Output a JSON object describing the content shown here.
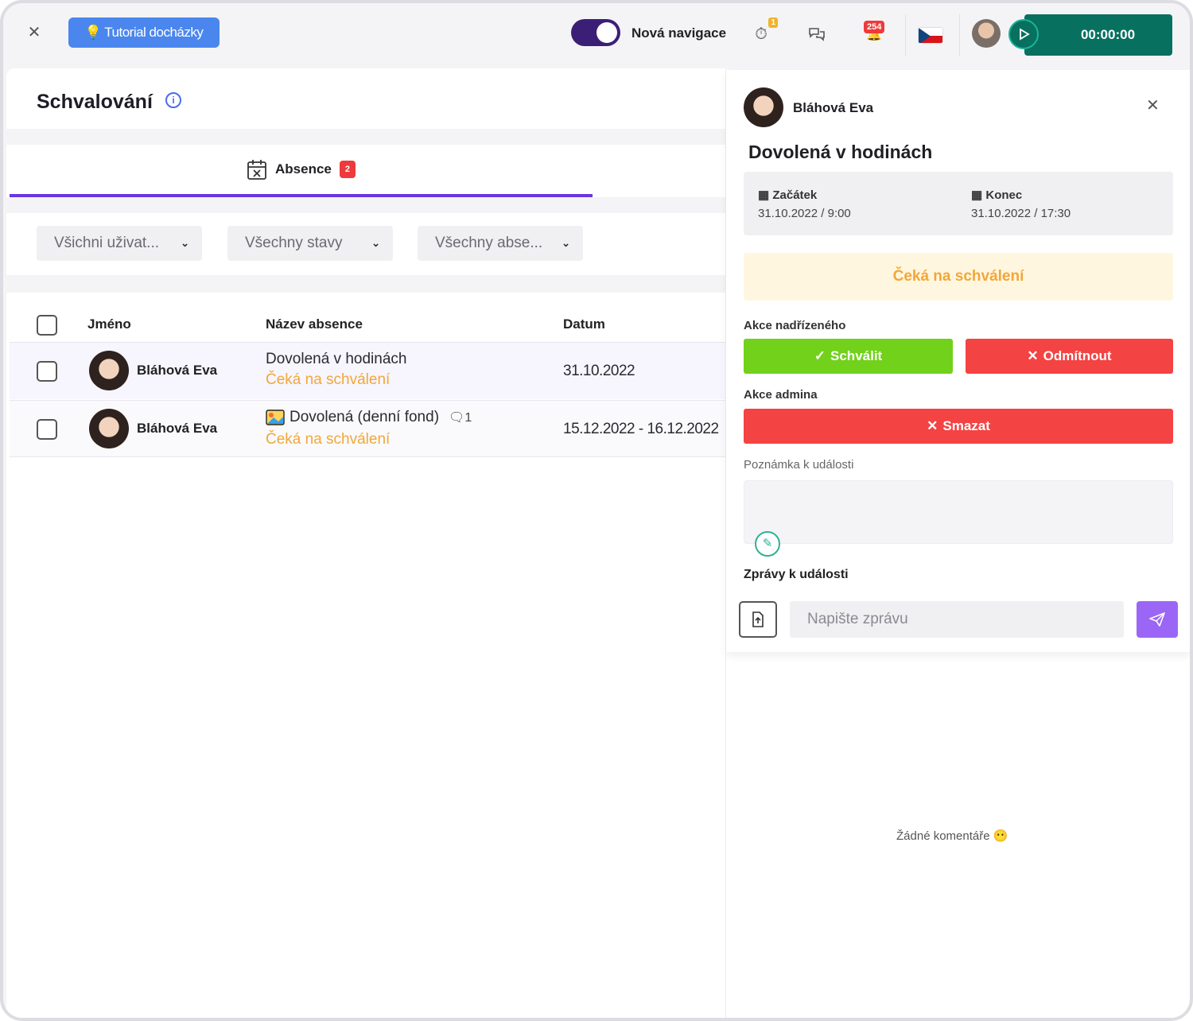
{
  "topbar": {
    "tutorial_label": "Tutorial docházky",
    "nav_toggle_label": "Nová navigace",
    "nav_toggle_on": true,
    "alerts_badge": "1",
    "notifications_badge": "254",
    "timer": "00:00:00",
    "language": "CZ"
  },
  "page": {
    "title": "Schvalování"
  },
  "tabs": [
    {
      "label": "Absence",
      "badge": "2"
    }
  ],
  "filters": [
    {
      "value": "Všichni uživat..."
    },
    {
      "value": "Všechny stavy"
    },
    {
      "value": "Všechny abse..."
    }
  ],
  "table": {
    "columns": [
      "Jméno",
      "Název absence",
      "Datum"
    ],
    "rows": [
      {
        "name": "Bláhová Eva",
        "absence": "Dovolená v hodinách",
        "status": "Čeká na schválení",
        "date": "31.10.2022"
      },
      {
        "name": "Bláhová Eva",
        "absence": "Dovolená (denní fond)",
        "comments": "1",
        "status": "Čeká na schválení",
        "date": "15.12.2022 - 16.12.2022"
      }
    ]
  },
  "detail": {
    "user_name": "Bláhová Eva",
    "title": "Dovolená v hodinách",
    "start_label": "Začátek",
    "start_value": "31.10.2022 / 9:00",
    "end_label": "Konec",
    "end_value": "31.10.2022 / 17:30",
    "status": "Čeká na schválení",
    "supervisor_section": "Akce nadřízeného",
    "approve_label": "Schválit",
    "reject_label": "Odmítnout",
    "admin_section": "Akce admina",
    "delete_label": "Smazat",
    "note_label": "Poznámka k události",
    "messages_label": "Zprávy k události",
    "message_placeholder": "Napište zprávu",
    "no_comments": "Žádné komentáře"
  },
  "colors": {
    "accent": "#6a34e6",
    "approve": "#72d11b",
    "reject": "#f44343",
    "pending": "#f2a73a",
    "timer_bg": "#07705f"
  }
}
